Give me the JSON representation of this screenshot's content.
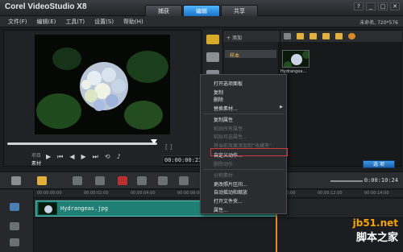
{
  "app": {
    "title": "Corel VideoStudio X8",
    "project_name": "未命名, 720*576"
  },
  "mode_tabs": [
    "捕获",
    "编辑",
    "共享"
  ],
  "window_controls": [
    "?",
    "_",
    "□",
    "✕"
  ],
  "menu": [
    "文件(F)",
    "编辑(E)",
    "工具(T)",
    "设置(S)",
    "帮助(H)"
  ],
  "preview": {
    "project_label": "项目",
    "clip_label": "素材",
    "timecode": "00:00:00:23",
    "position_fraction": 0.98,
    "transport_icons": [
      "play-icon",
      "skip-start-icon",
      "step-back-icon",
      "step-forward-icon",
      "skip-end-icon",
      "repeat-icon",
      "volume-icon"
    ]
  },
  "library": {
    "add_label": "添加",
    "folder_label": "样本",
    "thumb_label": "Hydrangea...",
    "options_label": "选 项"
  },
  "context_menu": {
    "items": [
      {
        "label": "打开选项面板",
        "disabled": false,
        "submenu": false
      },
      {
        "label": "复制",
        "disabled": false,
        "submenu": false
      },
      {
        "label": "删除",
        "disabled": false,
        "submenu": false
      },
      {
        "label": "替换素材...",
        "disabled": false,
        "submenu": true
      },
      {
        "label": "复制属性",
        "disabled": false,
        "submenu": false
      },
      {
        "label": "粘贴所有属性",
        "disabled": true,
        "submenu": false
      },
      {
        "label": "粘贴可选属性...",
        "disabled": true,
        "submenu": false
      },
      {
        "label": "将当前效果添加到“收藏夹”",
        "disabled": true,
        "submenu": false
      },
      {
        "label": "自定义动作...",
        "disabled": false,
        "submenu": false,
        "highlighted": true
      },
      {
        "label": "删除动作",
        "disabled": true,
        "submenu": false
      },
      {
        "label": "分割素材",
        "disabled": true,
        "submenu": false
      },
      {
        "label": "更改照片区间...",
        "disabled": false,
        "submenu": false
      },
      {
        "label": "自动摇动和缩放",
        "disabled": false,
        "submenu": false
      },
      {
        "label": "打开文件夹...",
        "disabled": false,
        "submenu": false
      },
      {
        "label": "属性...",
        "disabled": false,
        "submenu": false
      }
    ]
  },
  "timeline": {
    "timecode": "0:00:10:24",
    "ruler_ticks": [
      "00:00:00:00",
      "00:00:02:00",
      "00:00:04:00",
      "00:00:06:00",
      "00:00:08:00",
      "00:00:10:00",
      "00:00:12:00",
      "00:00:14:00"
    ],
    "clip_name": "Hydrangeas.jpg"
  },
  "watermark": {
    "site": "jb51.net",
    "brand": "脚本之家"
  },
  "colors": {
    "accent": "#1b73c7",
    "clip": "#1f7f74",
    "highlight": "#d0393b",
    "watermark": "#f5a300"
  }
}
